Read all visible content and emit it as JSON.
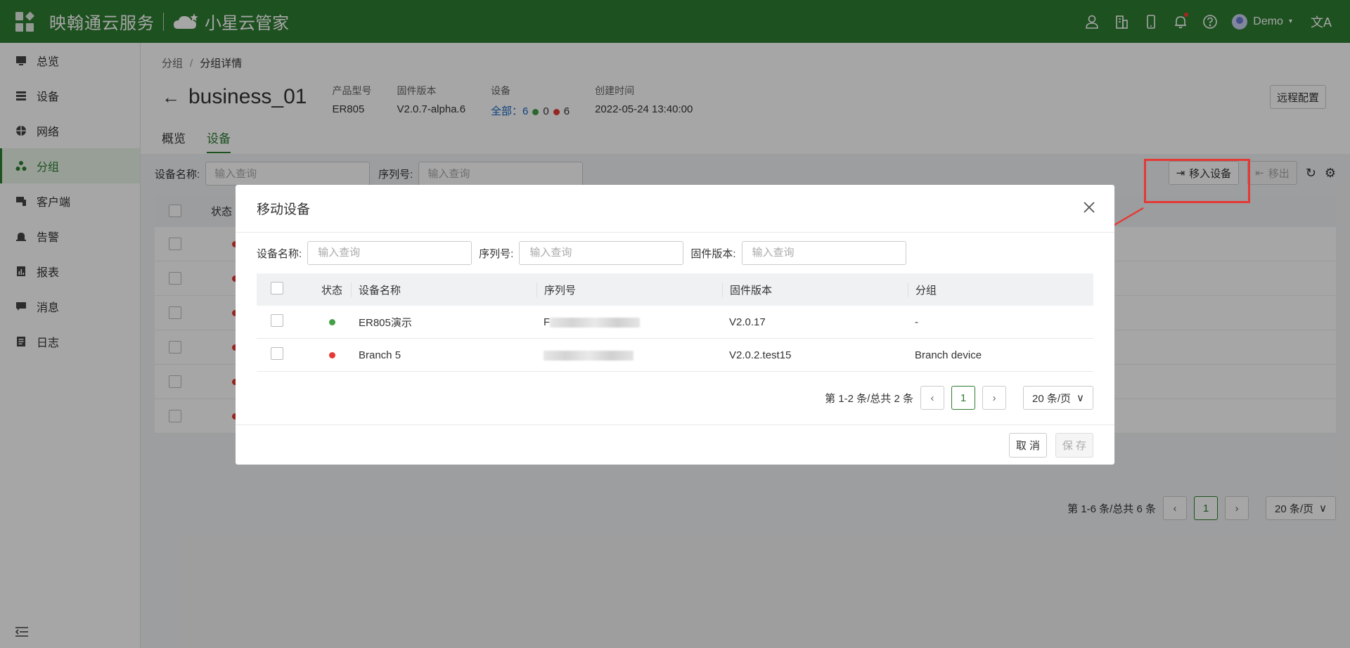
{
  "topbar": {
    "brand": "映翰通云服务",
    "brand2": "小星云管家",
    "user": "Demo",
    "lang_glyph": "文A"
  },
  "sidebar": {
    "items": [
      {
        "label": "总览",
        "icon": "dashboard-icon"
      },
      {
        "label": "设备",
        "icon": "device-icon"
      },
      {
        "label": "网络",
        "icon": "globe-icon"
      },
      {
        "label": "分组",
        "icon": "group-icon",
        "active": true
      },
      {
        "label": "客户端",
        "icon": "client-icon"
      },
      {
        "label": "告警",
        "icon": "alarm-icon"
      },
      {
        "label": "报表",
        "icon": "report-icon"
      },
      {
        "label": "消息",
        "icon": "message-icon"
      },
      {
        "label": "日志",
        "icon": "log-icon"
      }
    ]
  },
  "breadcrumb": {
    "parent": "分组",
    "current": "分组详情"
  },
  "header": {
    "title": "business_01",
    "meta": {
      "model_label": "产品型号",
      "model": "ER805",
      "fw_label": "固件版本",
      "fw": "V2.0.7-alpha.6",
      "device_label": "设备",
      "device_all": "全部：6",
      "online": "0",
      "offline": "6",
      "created_label": "创建时间",
      "created": "2022-05-24 13:40:00"
    },
    "remote_btn": "远程配置",
    "tabs": [
      "概览",
      "设备"
    ]
  },
  "list": {
    "name_label": "设备名称:",
    "name_placeholder": "输入查询",
    "sn_label": "序列号:",
    "sn_placeholder": "输入查询",
    "move_in": "移入设备",
    "move_out": "移出",
    "status_col": "状态",
    "pager_text": "第 1-6 条/总共 6 条",
    "page": "1",
    "page_size": "20 条/页"
  },
  "modal": {
    "title": "移动设备",
    "filters": {
      "name_label": "设备名称:",
      "name_placeholder": "输入查询",
      "sn_label": "序列号:",
      "sn_placeholder": "输入查询",
      "fw_label": "固件版本:",
      "fw_placeholder": "输入查询"
    },
    "columns": [
      "状态",
      "设备名称",
      "序列号",
      "固件版本",
      "分组"
    ],
    "rows": [
      {
        "status": "online",
        "status_color": "#43a047",
        "name": "ER805演示",
        "sn_prefix": "F",
        "fw": "V2.0.17",
        "group": "-"
      },
      {
        "status": "offline",
        "status_color": "#e53935",
        "name": "Branch 5",
        "sn_prefix": "",
        "fw": "V2.0.2.test15",
        "group": "Branch device"
      }
    ],
    "pager_text": "第 1-2 条/总共 2 条",
    "page": "1",
    "page_size": "20 条/页",
    "cancel": "取 消",
    "save": "保 存"
  },
  "colors": {
    "brand_green": "#2e7d32",
    "highlight_red": "#e53935"
  }
}
